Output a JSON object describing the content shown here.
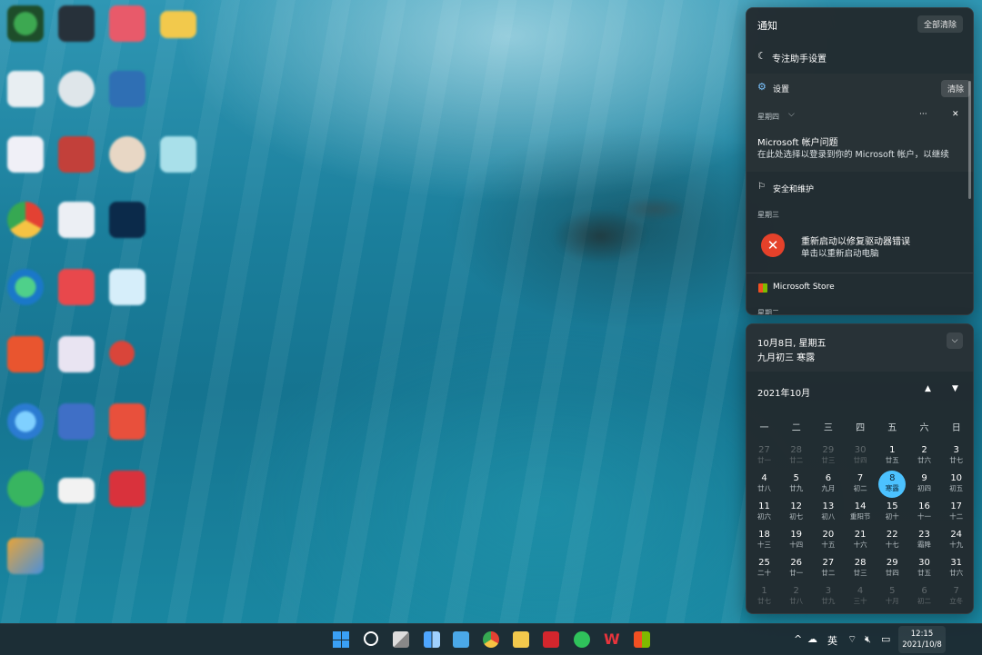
{
  "notification_center": {
    "title": "通知",
    "clear_all": "全部清除",
    "focus_assist": "专注助手设置",
    "groups": [
      {
        "app": "设置",
        "clear": "清除",
        "day": "星期四",
        "notif_title": "Microsoft 帐户问题",
        "notif_body": "在此处选择以登录到你的 Microsoft 帐户，以继续",
        "more": "···",
        "close": "✕"
      },
      {
        "app": "安全和维护",
        "day": "星期三",
        "notif_title": "重新启动以修复驱动器错误",
        "notif_body": "单击以重新启动电脑"
      },
      {
        "app": "Microsoft Store",
        "day": "星期二"
      }
    ]
  },
  "calendar": {
    "date_line": "10月8日, 星期五",
    "lunar_line": "九月初三 寒露",
    "month_title": "2021年10月",
    "weekdays": [
      "一",
      "二",
      "三",
      "四",
      "五",
      "六",
      "日"
    ],
    "days": [
      {
        "n": "27",
        "l": "廿一",
        "dim": true
      },
      {
        "n": "28",
        "l": "廿二",
        "dim": true
      },
      {
        "n": "29",
        "l": "廿三",
        "dim": true
      },
      {
        "n": "30",
        "l": "廿四",
        "dim": true
      },
      {
        "n": "1",
        "l": "廿五"
      },
      {
        "n": "2",
        "l": "廿六"
      },
      {
        "n": "3",
        "l": "廿七"
      },
      {
        "n": "4",
        "l": "廿八"
      },
      {
        "n": "5",
        "l": "廿九"
      },
      {
        "n": "6",
        "l": "九月"
      },
      {
        "n": "7",
        "l": "初二"
      },
      {
        "n": "8",
        "l": "寒露",
        "today": true
      },
      {
        "n": "9",
        "l": "初四"
      },
      {
        "n": "10",
        "l": "初五"
      },
      {
        "n": "11",
        "l": "初六"
      },
      {
        "n": "12",
        "l": "初七"
      },
      {
        "n": "13",
        "l": "初八"
      },
      {
        "n": "14",
        "l": "重阳节"
      },
      {
        "n": "15",
        "l": "初十"
      },
      {
        "n": "16",
        "l": "十一"
      },
      {
        "n": "17",
        "l": "十二"
      },
      {
        "n": "18",
        "l": "十三"
      },
      {
        "n": "19",
        "l": "十四"
      },
      {
        "n": "20",
        "l": "十五"
      },
      {
        "n": "21",
        "l": "十六"
      },
      {
        "n": "22",
        "l": "十七"
      },
      {
        "n": "23",
        "l": "霜降"
      },
      {
        "n": "24",
        "l": "十九"
      },
      {
        "n": "25",
        "l": "二十"
      },
      {
        "n": "26",
        "l": "廿一"
      },
      {
        "n": "27",
        "l": "廿二"
      },
      {
        "n": "28",
        "l": "廿三"
      },
      {
        "n": "29",
        "l": "廿四"
      },
      {
        "n": "30",
        "l": "廿五"
      },
      {
        "n": "31",
        "l": "廿六"
      },
      {
        "n": "1",
        "l": "廿七",
        "dim": true
      },
      {
        "n": "2",
        "l": "廿八",
        "dim": true
      },
      {
        "n": "3",
        "l": "廿九",
        "dim": true
      },
      {
        "n": "4",
        "l": "三十",
        "dim": true
      },
      {
        "n": "5",
        "l": "十月",
        "dim": true
      },
      {
        "n": "6",
        "l": "初二",
        "dim": true
      },
      {
        "n": "7",
        "l": "立冬",
        "dim": true
      }
    ]
  },
  "taskbar": {
    "ime": "英",
    "time": "12:15",
    "date": "2021/10/8",
    "tray_up": "^"
  },
  "colors": {
    "accent": "#4cc2ff",
    "error_red": "#e5412a"
  }
}
